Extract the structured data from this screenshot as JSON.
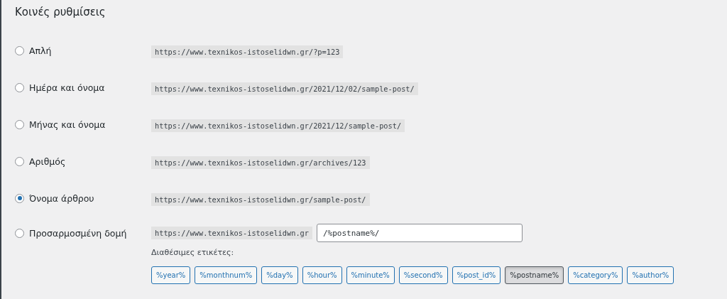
{
  "heading": "Κοινές ρυθμίσεις",
  "options": [
    {
      "label": "Απλή",
      "selected": false,
      "example": "https://www.texnikos-istoselidwn.gr/?p=123"
    },
    {
      "label": "Ημέρα και όνομα",
      "selected": false,
      "example": "https://www.texnikos-istoselidwn.gr/2021/12/02/sample-post/"
    },
    {
      "label": "Μήνας και όνομα",
      "selected": false,
      "example": "https://www.texnikos-istoselidwn.gr/2021/12/sample-post/"
    },
    {
      "label": "Αριθμός",
      "selected": false,
      "example": "https://www.texnikos-istoselidwn.gr/archives/123"
    },
    {
      "label": "Όνομα άρθρου",
      "selected": true,
      "example": "https://www.texnikos-istoselidwn.gr/sample-post/"
    }
  ],
  "custom": {
    "label": "Προσαρμοσμένη δομή",
    "selected": false,
    "prefix": "https://www.texnikos-istoselidwn.gr",
    "value": "/%postname%/",
    "tags_label": "Διαθέσιμες ετικέτες:",
    "tags": [
      {
        "label": "%year%",
        "selected": false
      },
      {
        "label": "%monthnum%",
        "selected": false
      },
      {
        "label": "%day%",
        "selected": false
      },
      {
        "label": "%hour%",
        "selected": false
      },
      {
        "label": "%minute%",
        "selected": false
      },
      {
        "label": "%second%",
        "selected": false
      },
      {
        "label": "%post_id%",
        "selected": false
      },
      {
        "label": "%postname%",
        "selected": true
      },
      {
        "label": "%category%",
        "selected": false
      },
      {
        "label": "%author%",
        "selected": false
      }
    ]
  }
}
